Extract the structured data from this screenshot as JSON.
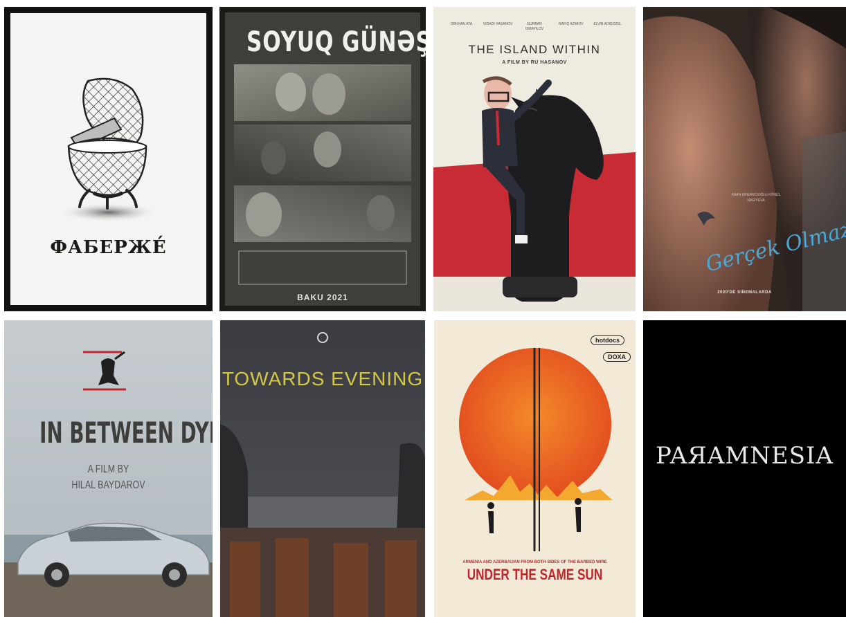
{
  "posters": {
    "faberge": {
      "title": "ФАБЕРЖЕ́"
    },
    "soyuq_gunes": {
      "title": "SOYUQ GÜNƏŞ",
      "city": "BAKU 2021"
    },
    "island_within": {
      "title": "THE ISLAND WITHIN",
      "byline_prefix": "A FILM BY ",
      "byline_name": "RU HASANOV",
      "cast": [
        "ORKHAN ATA",
        "VIDADI HASANOV",
        "GURBAN ISMAYILOV",
        "RAFIQ AZIMOV",
        "ELVIN ADIGOZEL"
      ]
    },
    "gercek_olmaz": {
      "script_title": "Gerçek Olmaz",
      "cast": "KAAN URGANCIOĞLU  KÖNÜL NAGIYEVA",
      "release": "2020'DE SINEMALARDA"
    },
    "in_between_dying": {
      "title": "IN BETWEEN DYING",
      "credit_line1": "A FILM BY",
      "credit_line2": "HILAL BAYDAROV"
    },
    "towards_evening": {
      "title": "TOWARDS EVENING"
    },
    "under_same_sun": {
      "tagline": "ARMENIA AND AZERBAIJAN FROM BOTH SIDES OF THE BARBED WIRE",
      "title": "UNDER THE SAME SUN",
      "badge1": "hotdocs",
      "badge2": "DOXA"
    },
    "paramnesia": {
      "title": "PAЯAMNESIA"
    }
  },
  "colors": {
    "sun": "#ea5a21",
    "accent_red": "#c0262d",
    "script_blue": "#4aa8d8",
    "towards_yellow": "#d2c846"
  },
  "icons": {
    "faberge": "egg-icon",
    "island": "chess-knight-icon",
    "in_between": "climber-icon",
    "towards": "festival-logo-icon",
    "same_sun": "sun-icon"
  }
}
